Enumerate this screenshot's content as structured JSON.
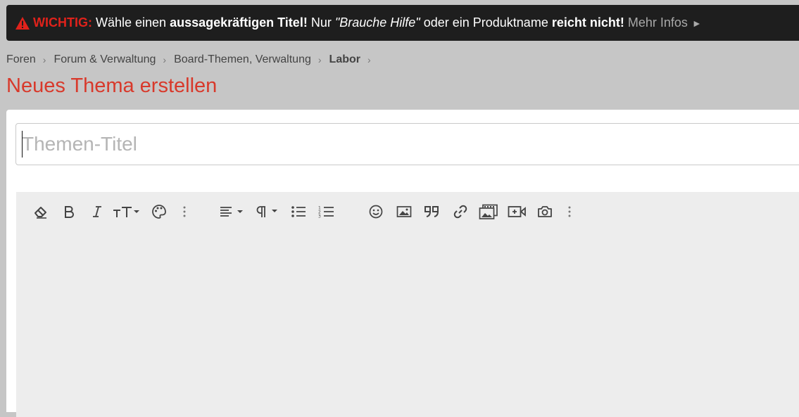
{
  "notice": {
    "label": "WICHTIG:",
    "text_1": "Wähle einen",
    "bold_1": "aussagekräftigen Titel!",
    "text_2": "Nur",
    "italic_1": "\"Brauche Hilfe\"",
    "text_3": "oder ein Produktname",
    "bold_2": "reicht nicht!",
    "more_link": "Mehr Infos",
    "more_icon": "►",
    "warn_color": "#e0221b"
  },
  "breadcrumb": {
    "items": [
      "Foren",
      "Forum & Verwaltung",
      "Board-Themen, Verwaltung",
      "Labor"
    ],
    "separator": "›"
  },
  "page": {
    "title": "Neues Thema erstellen",
    "title_color": "#d8392b"
  },
  "form": {
    "title_input": {
      "value": "",
      "placeholder": "Themen-Titel"
    }
  },
  "editor": {
    "toolbar": [
      "eraser-icon",
      "bold-icon",
      "italic-icon",
      "text-size-icon",
      "palette-icon",
      "more-vertical-icon",
      "align-left-icon",
      "paragraph-icon",
      "bullet-list-icon",
      "numbered-list-icon",
      "smiley-icon",
      "image-icon",
      "quote-icon",
      "link-icon",
      "gallery-icon",
      "video-icon",
      "camera-icon",
      "more-vertical-icon"
    ]
  }
}
